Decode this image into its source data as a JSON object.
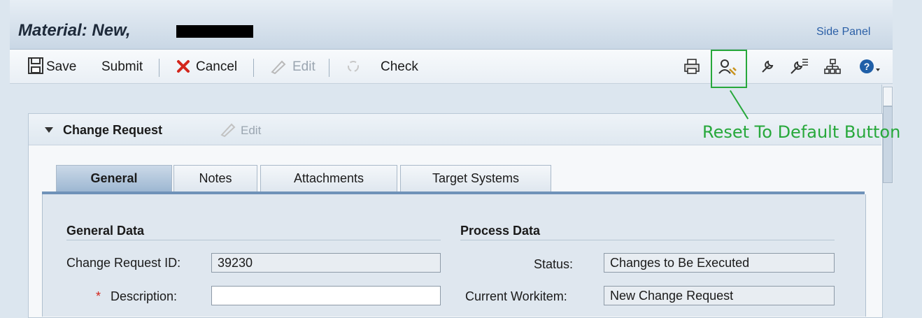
{
  "window": {
    "title": "Material: New,",
    "side_panel": "Side Panel"
  },
  "toolbar": {
    "save": "Save",
    "submit": "Submit",
    "cancel": "Cancel",
    "edit": "Edit",
    "check": "Check"
  },
  "change_request": {
    "title": "Change Request",
    "edit": "Edit"
  },
  "tabs": [
    "General",
    "Notes",
    "Attachments",
    "Target Systems"
  ],
  "general_data": {
    "heading": "General Data",
    "id_label": "Change Request ID:",
    "id_value": "39230",
    "desc_required": "*",
    "desc_label": "Description:",
    "desc_value": ""
  },
  "process_data": {
    "heading": "Process Data",
    "status_label": "Status:",
    "status_value": "Changes to Be Executed",
    "workitem_label": "Current Workitem:",
    "workitem_value": "New Change Request"
  },
  "annotation": {
    "text": "Reset To Default Button",
    "color": "#27a83b"
  },
  "icons": [
    "save-icon",
    "cancel-icon",
    "edit-icon",
    "check-icon",
    "print-icon",
    "reset-to-default-icon",
    "settings-wrench-icon",
    "personalize-icon",
    "hierarchy-icon",
    "help-icon"
  ]
}
